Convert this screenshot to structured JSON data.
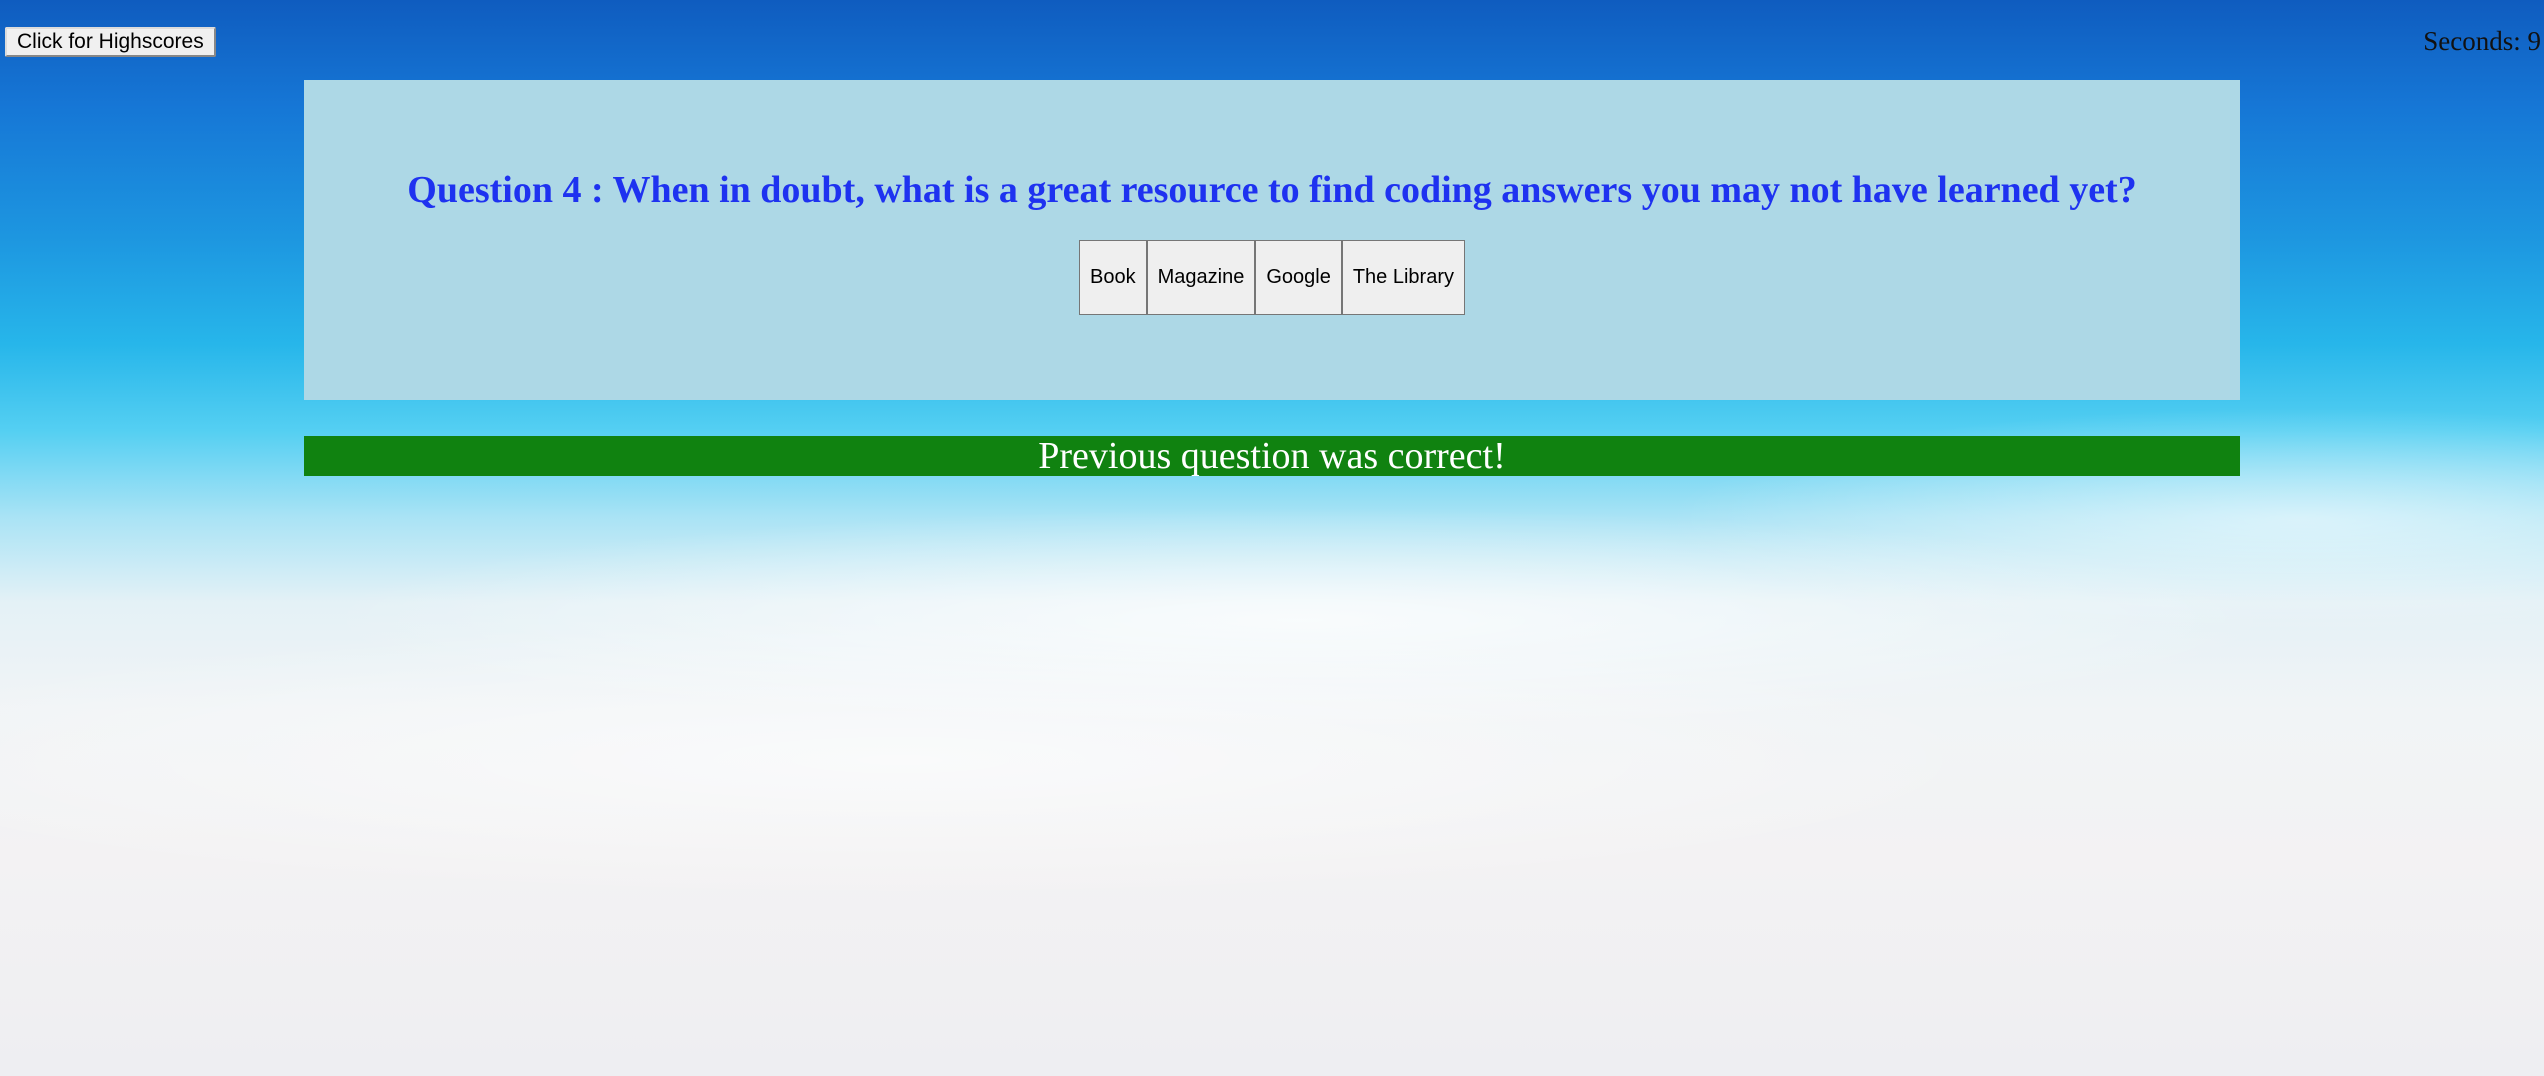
{
  "header": {
    "highscores_button": "Click for Highscores",
    "timer_text": "Seconds: 9"
  },
  "question": {
    "title": "Question 4 : When in doubt, what is a great resource to find coding answers you may not have learned yet?",
    "answers": [
      "Book",
      "Magazine",
      "Google",
      "The Library"
    ]
  },
  "feedback": {
    "message": "Previous question was correct!"
  },
  "colors": {
    "question_card_bg": "#add8e6",
    "question_text": "#1e32f0",
    "feedback_bg": "#108210",
    "feedback_text": "#ffffff"
  }
}
